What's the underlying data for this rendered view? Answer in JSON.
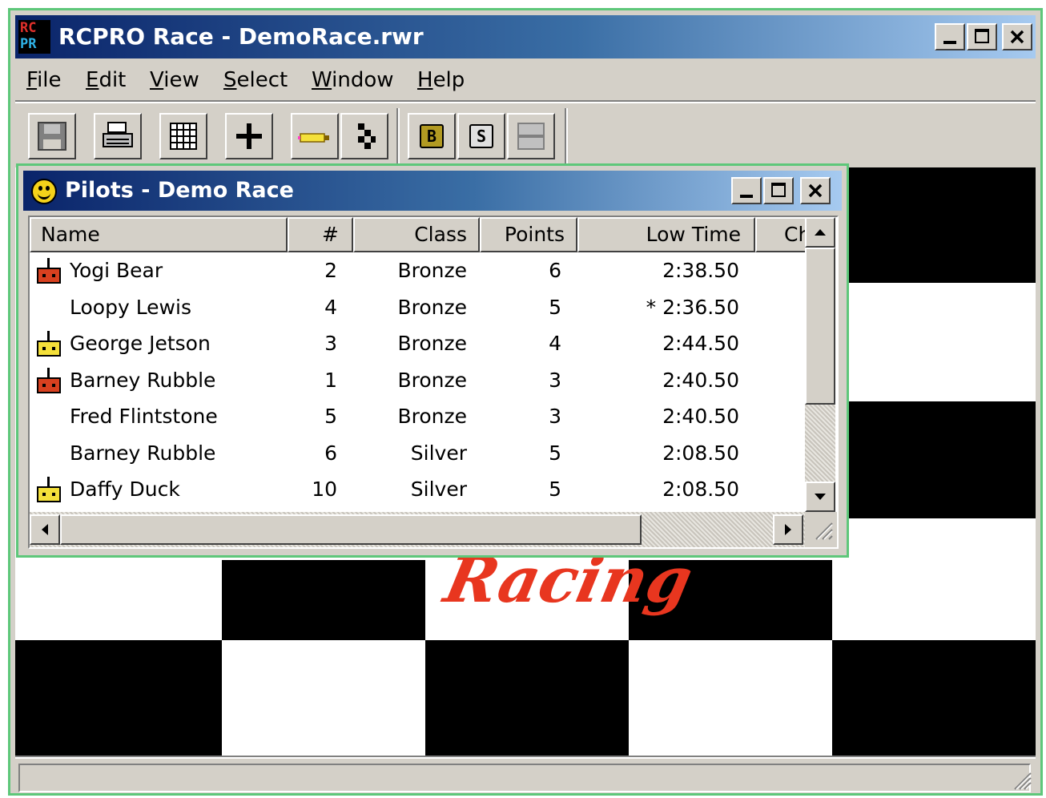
{
  "app": {
    "title": "RCPRO Race - DemoRace.rwr",
    "icon_line1": "RC",
    "icon_line2": "PR",
    "window_buttons": [
      "minimize-icon",
      "maximize-icon",
      "close-icon"
    ]
  },
  "menu": [
    {
      "accel": "F",
      "rest": "ile"
    },
    {
      "accel": "E",
      "rest": "dit"
    },
    {
      "accel": "V",
      "rest": "iew"
    },
    {
      "accel": "S",
      "rest": "elect"
    },
    {
      "accel": "W",
      "rest": "indow"
    },
    {
      "accel": "H",
      "rest": "elp"
    }
  ],
  "toolbar": {
    "buttons": [
      "save-icon",
      "print-icon",
      "grid-icon",
      "add-icon",
      "highlighter-icon",
      "checkered-flag-icon",
      "bronze-class-icon",
      "silver-class-icon",
      "window-icon"
    ],
    "bronze_label": "B",
    "silver_label": "S"
  },
  "background_logo_text": "Racing",
  "pilots_window": {
    "title": "Pilots - Demo Race",
    "columns": [
      "Name",
      "#",
      "Class",
      "Points",
      "Low Time",
      "Ch"
    ],
    "rows": [
      {
        "icon": "red-radio-transmitter-icon",
        "name": "Yogi Bear",
        "num": "2",
        "class": "Bronze",
        "points": "6",
        "low_time": "2:38.50"
      },
      {
        "icon": "",
        "name": "Loopy Lewis",
        "num": "4",
        "class": "Bronze",
        "points": "5",
        "low_time": "* 2:36.50"
      },
      {
        "icon": "yellow-radio-transmitter-icon",
        "name": "George Jetson",
        "num": "3",
        "class": "Bronze",
        "points": "4",
        "low_time": "2:44.50"
      },
      {
        "icon": "red-radio-transmitter-icon",
        "name": "Barney Rubble",
        "num": "1",
        "class": "Bronze",
        "points": "3",
        "low_time": "2:40.50"
      },
      {
        "icon": "",
        "name": "Fred Flintstone",
        "num": "5",
        "class": "Bronze",
        "points": "3",
        "low_time": "2:40.50"
      },
      {
        "icon": "",
        "name": "Barney Rubble",
        "num": "6",
        "class": "Silver",
        "points": "5",
        "low_time": "2:08.50"
      },
      {
        "icon": "yellow-radio-transmitter-icon",
        "name": "Daffy Duck",
        "num": "10",
        "class": "Silver",
        "points": "5",
        "low_time": "2:08.50"
      }
    ]
  },
  "colors": {
    "title_bar_start": "#0a246a",
    "title_bar_end": "#a6caf0",
    "window_border": "#5ec77a",
    "face": "#d4d0c8",
    "red_transmitter": "#d8401f",
    "yellow_transmitter": "#f4e03a",
    "racing_logo": "#e8361f"
  }
}
